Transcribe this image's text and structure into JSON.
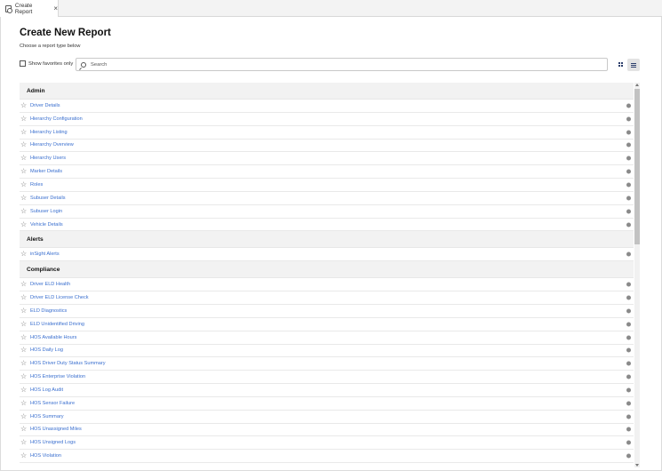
{
  "tab": {
    "title": "Create Report",
    "close": "×"
  },
  "page": {
    "title": "Create New Report",
    "subtitle": "Choose a report type below"
  },
  "filters": {
    "favorites_label": "Show favorites only",
    "search_placeholder": "Search"
  },
  "sections": [
    {
      "title": "Admin",
      "items": [
        "Driver Details",
        "Hierarchy Configuration",
        "Hierarchy Listing",
        "Hierarchy Overview",
        "Hierarchy Users",
        "Marker Details",
        "Roles",
        "Subuser Details",
        "Subuser Login",
        "Vehicle Details"
      ]
    },
    {
      "title": "Alerts",
      "items": [
        "inSight Alerts"
      ]
    },
    {
      "title": "Compliance",
      "items": [
        "Driver ELD Health",
        "Driver ELD License Check",
        "ELD Diagnostics",
        "ELD Unidentified Driving",
        "HOS Available Hours",
        "HOS Daily Log",
        "HOS Driver Duty Status Summary",
        "HOS Enterprise Violation",
        "HOS Log Audit",
        "HOS Sensor Failure",
        "HOS Summary",
        "HOS Unassigned Miles",
        "HOS Unsigned Logs",
        "HOS Violation"
      ]
    }
  ],
  "icons": {
    "favorite": "star-outline-icon",
    "info": "info-icon"
  },
  "colors": {
    "link": "#3a6fcf",
    "section_bg": "#f2f2f2",
    "view_icon": "#2c3e6b"
  }
}
